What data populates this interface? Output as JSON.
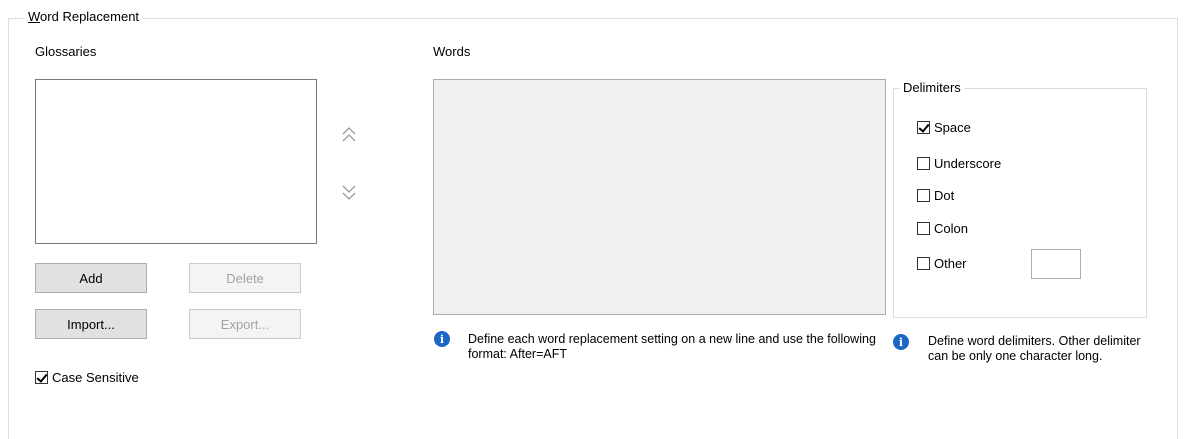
{
  "group": {
    "title": "Word Replacement"
  },
  "glossaries": {
    "label": "Glossaries",
    "buttons": {
      "add": "Add",
      "delete": "Delete",
      "import": "Import...",
      "export": "Export..."
    },
    "case_sensitive": {
      "label": "Case Sensitive",
      "checked": true
    }
  },
  "words": {
    "label": "Words",
    "info": "Define each word replacement setting on a new line and use the following format: After=AFT"
  },
  "delimiters": {
    "title": "Delimiters",
    "space": "Space",
    "underscore": "Underscore",
    "dot": "Dot",
    "colon": "Colon",
    "other": "Other",
    "info": "Define word delimiters. Other delimiter can be only one character long."
  },
  "colors": {
    "info_icon": "#1c66c7",
    "border": "#d5dfe5"
  },
  "icons": {
    "move_up": "double-chevron-up-icon",
    "move_down": "double-chevron-down-icon",
    "info": "info-icon"
  }
}
